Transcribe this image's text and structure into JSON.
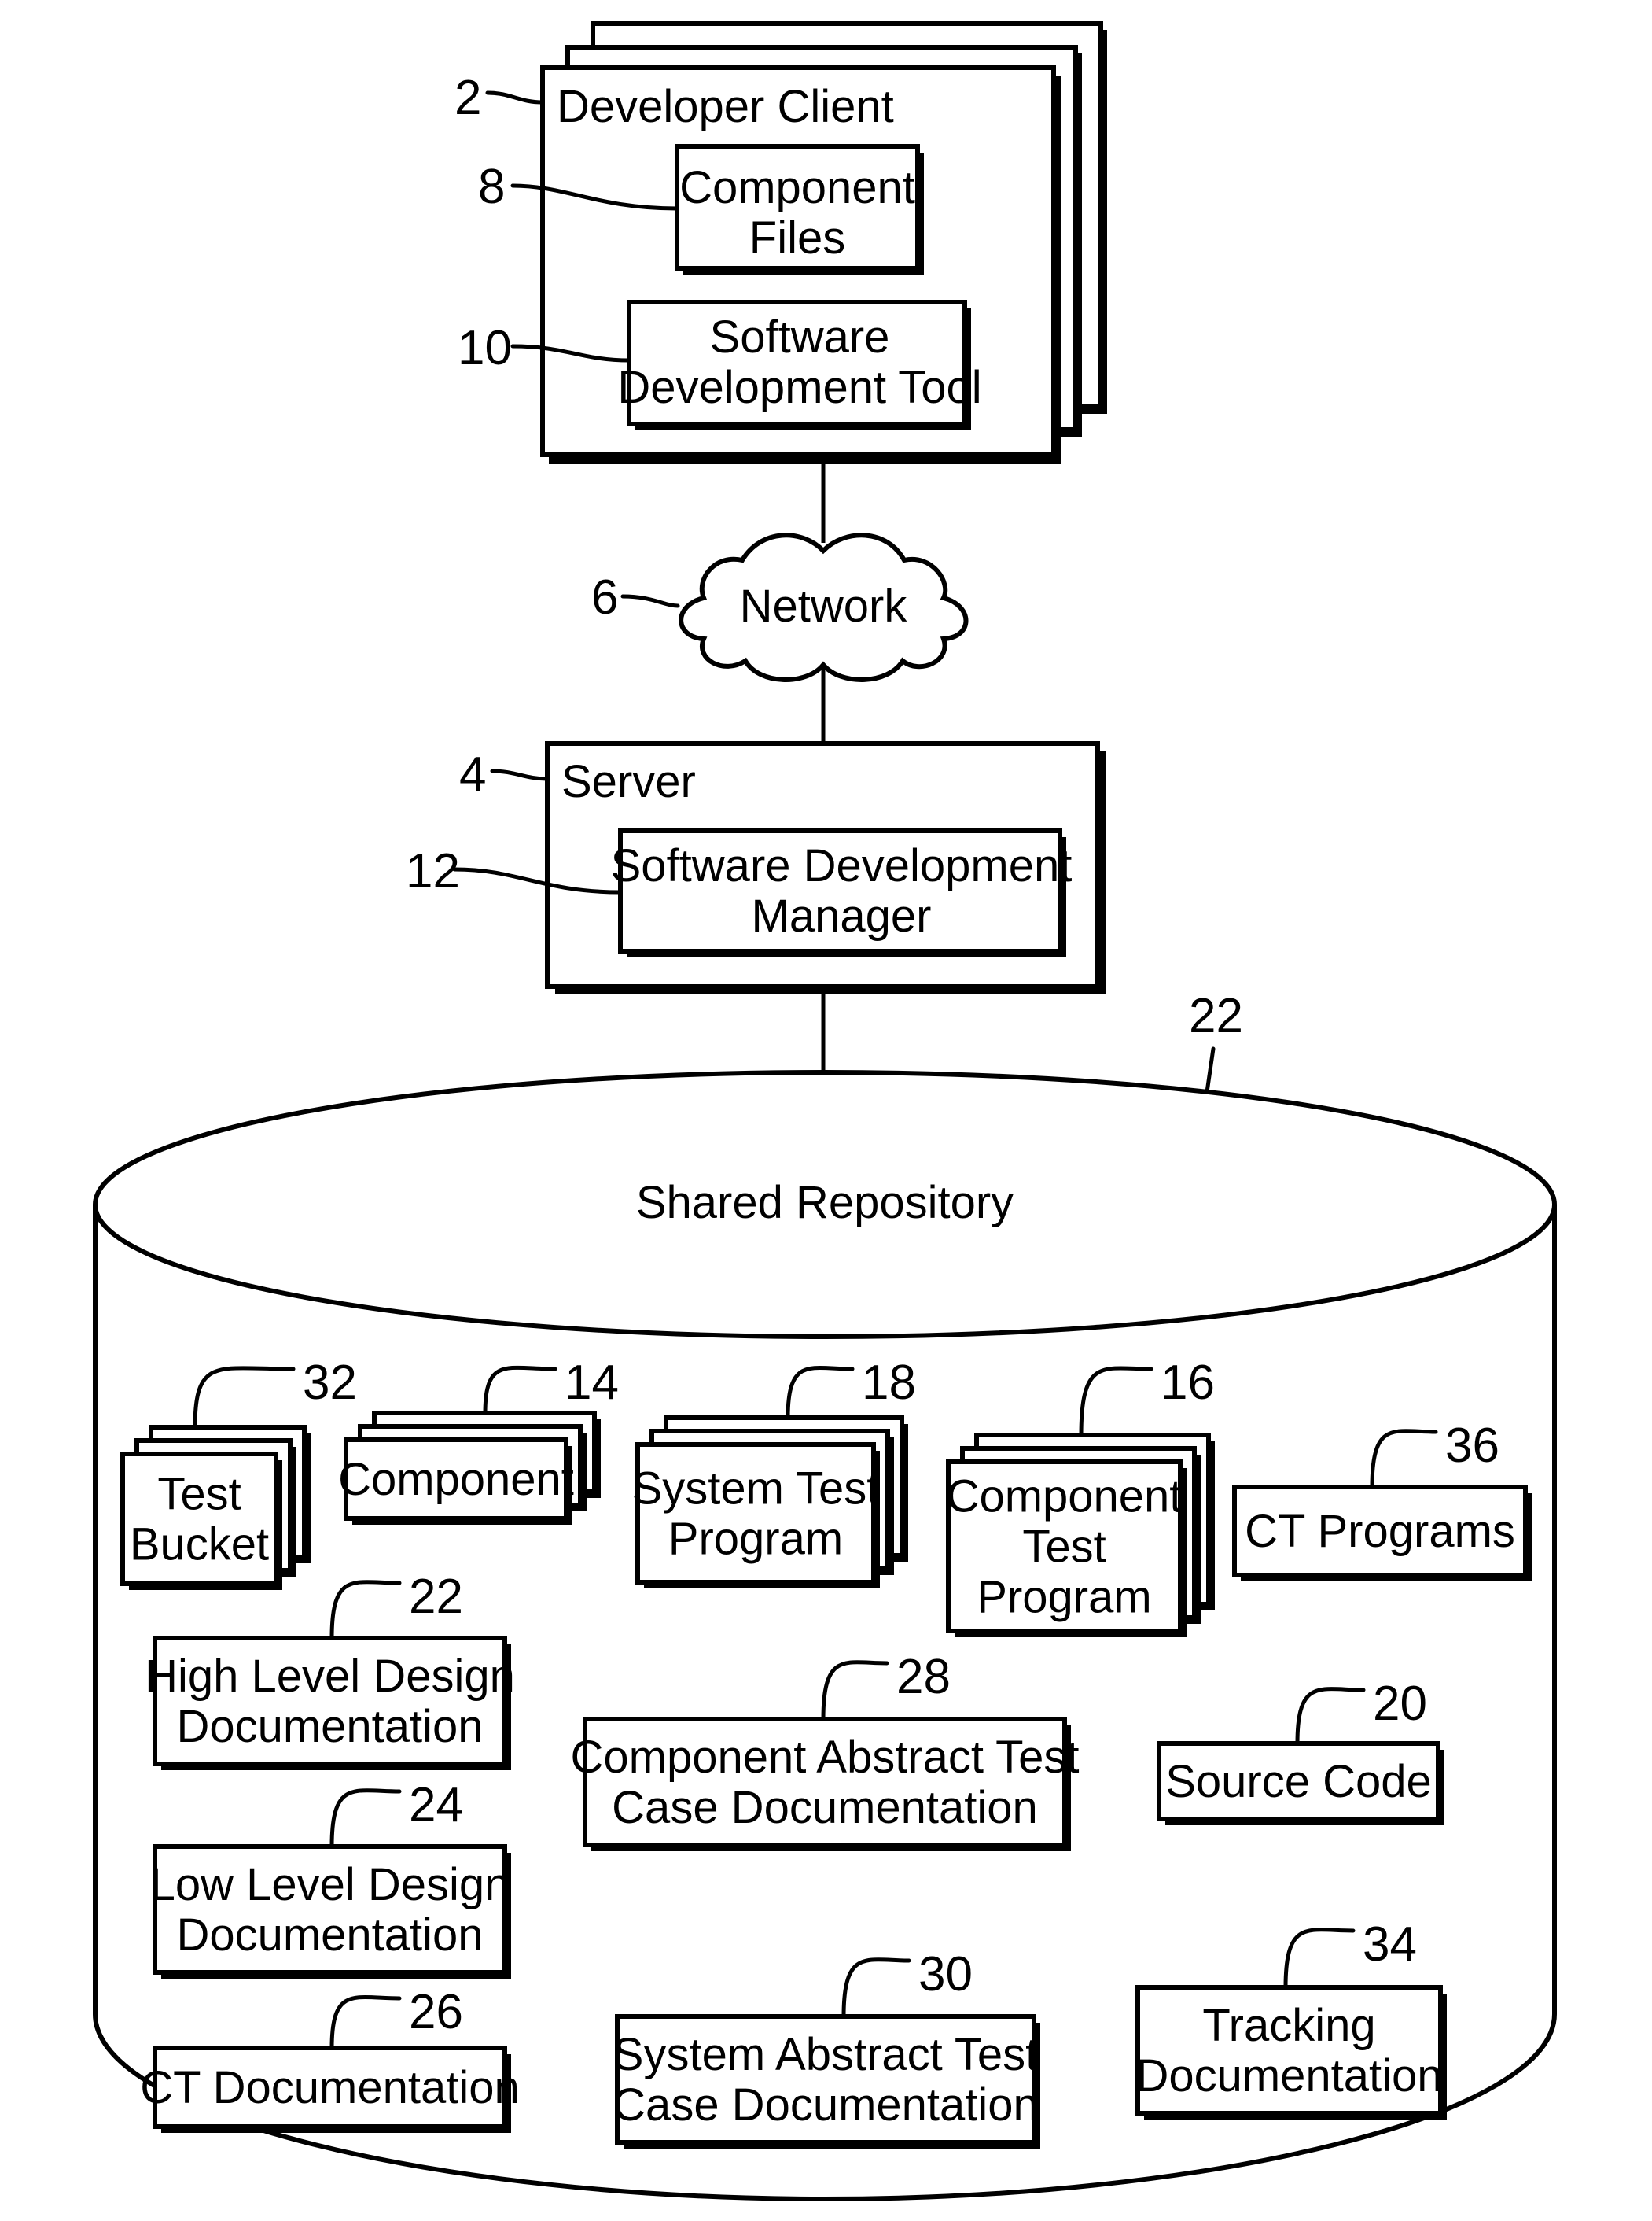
{
  "figure": {
    "developer_client": {
      "label": "Developer Client",
      "ref": "2"
    },
    "component_files": {
      "label_lines": [
        "Component",
        "Files"
      ],
      "ref": "8"
    },
    "software_development_tool": {
      "label_lines": [
        "Software",
        "Development Tool"
      ],
      "ref": "10"
    },
    "network": {
      "label": "Network",
      "ref": "6"
    },
    "server": {
      "label": "Server",
      "ref": "4"
    },
    "software_development_manager": {
      "label_lines": [
        "Software Development",
        "Manager"
      ],
      "ref": "12"
    },
    "shared_repository": {
      "label": "Shared Repository",
      "ref": "22"
    },
    "repository_items": [
      {
        "id": "test-bucket",
        "label_lines": [
          "Test",
          "Bucket"
        ],
        "ref": "32",
        "stacked": true
      },
      {
        "id": "component",
        "label_lines": [
          "Component"
        ],
        "ref": "14",
        "stacked": true
      },
      {
        "id": "system-test-program",
        "label_lines": [
          "System Test",
          "Program"
        ],
        "ref": "18",
        "stacked": true
      },
      {
        "id": "component-test-program",
        "label_lines": [
          "Component",
          "Test",
          "Program"
        ],
        "ref": "16",
        "stacked": true
      },
      {
        "id": "ct-programs",
        "label_lines": [
          "CT Programs"
        ],
        "ref": "36",
        "stacked": false
      },
      {
        "id": "high-level-design-documentation",
        "label_lines": [
          "High Level Design",
          "Documentation"
        ],
        "ref": "22",
        "stacked": false
      },
      {
        "id": "component-abstract-test-case-documentation",
        "label_lines": [
          "Component Abstract Test",
          "Case Documentation"
        ],
        "ref": "28",
        "stacked": false
      },
      {
        "id": "source-code",
        "label_lines": [
          "Source Code"
        ],
        "ref": "20",
        "stacked": false
      },
      {
        "id": "low-level-design-documentation",
        "label_lines": [
          "Low Level Design",
          "Documentation"
        ],
        "ref": "24",
        "stacked": false
      },
      {
        "id": "ct-documentation",
        "label_lines": [
          "CT Documentation"
        ],
        "ref": "26",
        "stacked": false
      },
      {
        "id": "system-abstract-test-case-documentation",
        "label_lines": [
          "System Abstract Test",
          "Case Documentation"
        ],
        "ref": "30",
        "stacked": false
      },
      {
        "id": "tracking-documentation",
        "label_lines": [
          "Tracking",
          "Documentation"
        ],
        "ref": "34",
        "stacked": false
      }
    ]
  }
}
